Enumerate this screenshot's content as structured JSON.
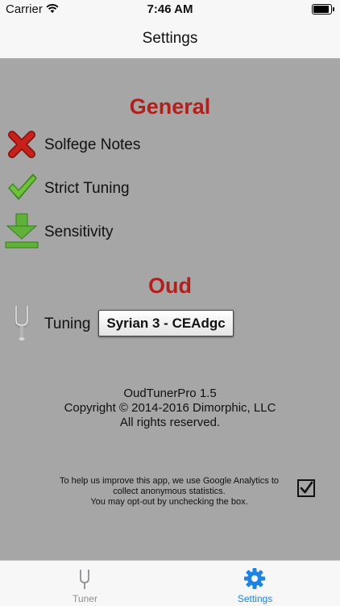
{
  "status_bar": {
    "carrier": "Carrier",
    "time": "7:46 AM",
    "battery_level": 1.0
  },
  "nav": {
    "title": "Settings"
  },
  "general": {
    "title": "General",
    "items": [
      {
        "label": "Solfege Notes",
        "icon": "x-mark-icon"
      },
      {
        "label": "Strict Tuning",
        "icon": "check-mark-icon"
      },
      {
        "label": "Sensitivity",
        "icon": "down-arrow-icon"
      }
    ]
  },
  "oud": {
    "title": "Oud",
    "tuning_label": "Tuning",
    "tuning_value": "Syrian 3 - CEAdgc"
  },
  "about": {
    "app_name": "OudTunerPro 1.5",
    "copyright": "Copyright © 2014-2016 Dimorphic, LLC",
    "rights": "All rights reserved."
  },
  "analytics": {
    "line1": "To help us improve this app, we use Google Analytics to",
    "line2": "collect anonymous statistics.",
    "line3": "You may opt-out by unchecking the box.",
    "checked": true
  },
  "tabs": [
    {
      "label": "Tuner",
      "icon": "tuning-fork-icon",
      "active": false
    },
    {
      "label": "Settings",
      "icon": "gear-icon",
      "active": true
    }
  ],
  "colors": {
    "background": "#a6a6a6",
    "section_title": "#b51f1a",
    "tab_active": "#1e83e6",
    "tab_inactive": "#8e8e93"
  }
}
